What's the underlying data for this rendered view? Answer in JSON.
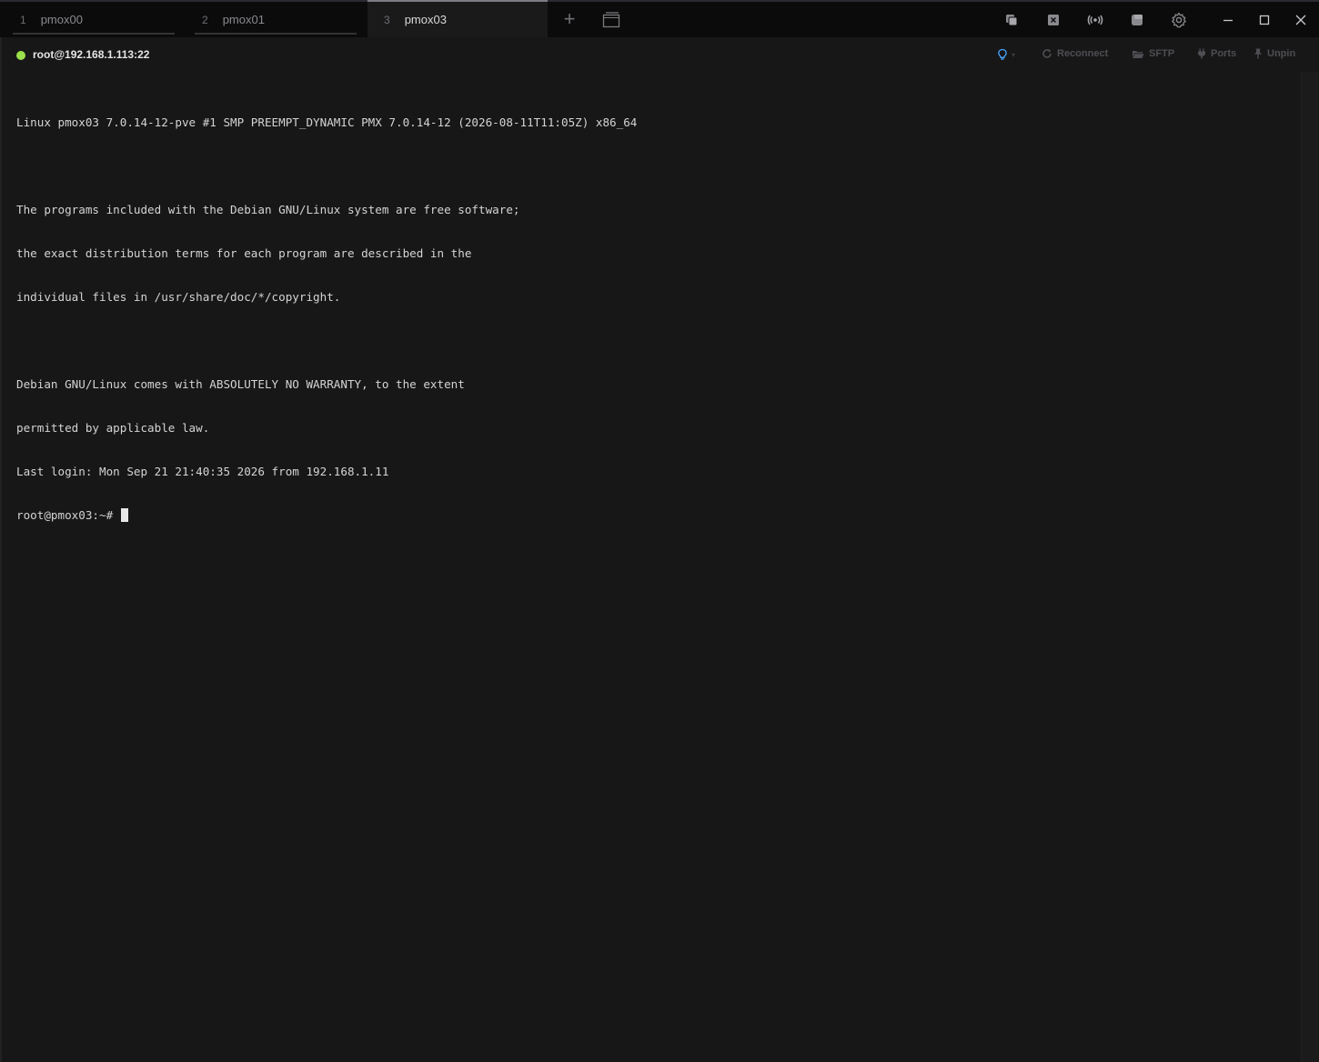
{
  "tabs": [
    {
      "number": "1",
      "label": "pmox00",
      "active": false
    },
    {
      "number": "2",
      "label": "pmox01",
      "active": false
    },
    {
      "number": "3",
      "label": "pmox03",
      "active": true
    }
  ],
  "tab_add_label": "+",
  "session": {
    "status": "connected",
    "status_color": "#9be04a",
    "host": "root@192.168.1.113:22",
    "actions": {
      "reconnect": "Reconnect",
      "sftp": "SFTP",
      "ports": "Ports",
      "unpin": "Unpin"
    }
  },
  "terminal": {
    "lines": [
      "Linux pmox03 7.0.14-12-pve #1 SMP PREEMPT_DYNAMIC PMX 7.0.14-12 (2026-08-11T11:05Z) x86_64",
      "",
      "The programs included with the Debian GNU/Linux system are free software;",
      "the exact distribution terms for each program are described in the",
      "individual files in /usr/share/doc/*/copyright.",
      "",
      "Debian GNU/Linux comes with ABSOLUTELY NO WARRANTY, to the extent",
      "permitted by applicable law.",
      "Last login: Mon Sep 21 21:40:35 2026 from 192.168.1.11"
    ],
    "prompt": "root@pmox03:~# "
  },
  "icons": {
    "toolbar": [
      "duplicate-icon",
      "close-all-icon",
      "broadcast-icon",
      "window-icon",
      "gear-icon"
    ],
    "window_controls": [
      "minimize-icon",
      "maximize-icon",
      "close-icon"
    ],
    "session": [
      "lightbulb-icon",
      "reconnect-icon",
      "folder-icon",
      "plug-icon",
      "pin-icon"
    ]
  },
  "colors": {
    "accent_bulb": "#4aa8ff",
    "terminal_fg": "#d4d4d4",
    "terminal_bg": "#171718"
  }
}
